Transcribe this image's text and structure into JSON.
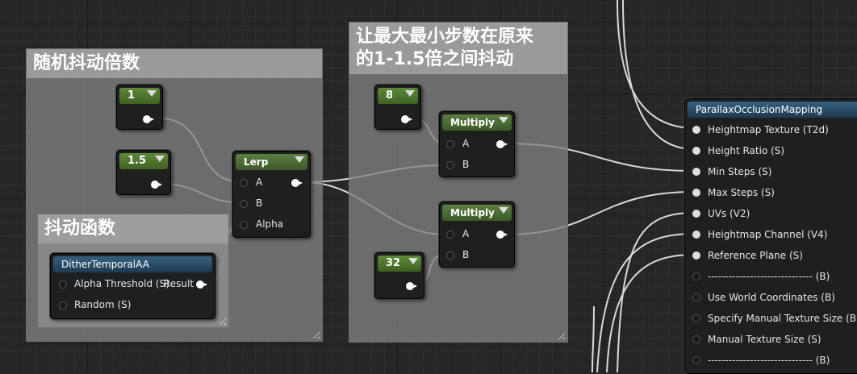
{
  "comments": {
    "dither": "随机抖动倍数",
    "dither_func": "抖动函数",
    "steps": "让最大最小步数在原来\n的1-1.5倍之间抖动"
  },
  "constants": {
    "c1": "1",
    "c15": "1.5",
    "c8": "8",
    "c32": "32"
  },
  "lerp": {
    "title": "Lerp",
    "a": "A",
    "b": "B",
    "alpha": "Alpha"
  },
  "multiply1": {
    "title": "Multiply",
    "a": "A",
    "b": "B"
  },
  "multiply2": {
    "title": "Multiply",
    "a": "A",
    "b": "B"
  },
  "dither_node": {
    "title": "DitherTemporalAA",
    "alpha_threshold": "Alpha Threshold (S)",
    "result": "Result",
    "random": "Random (S)"
  },
  "pom": {
    "title": "ParallaxOcclusionMapping",
    "inputs": [
      "Heightmap Texture (T2d)",
      "Height Ratio (S)",
      "Min Steps (S)",
      "Max Steps (S)",
      "UVs (V2)",
      "Heightmap Channel (V4)",
      "Reference Plane (S)",
      "------------------------------ (B)",
      "Use World Coordinates (B)",
      "Specify Manual Texture Size (B)",
      "Manual Texture Size (S)",
      "------------------------------ (B)"
    ]
  },
  "colors": {
    "wire": "#d9d9d9",
    "const_header": "#4f7a2f",
    "pom_header": "#2c4f6b",
    "comment_fill": "#808080"
  }
}
